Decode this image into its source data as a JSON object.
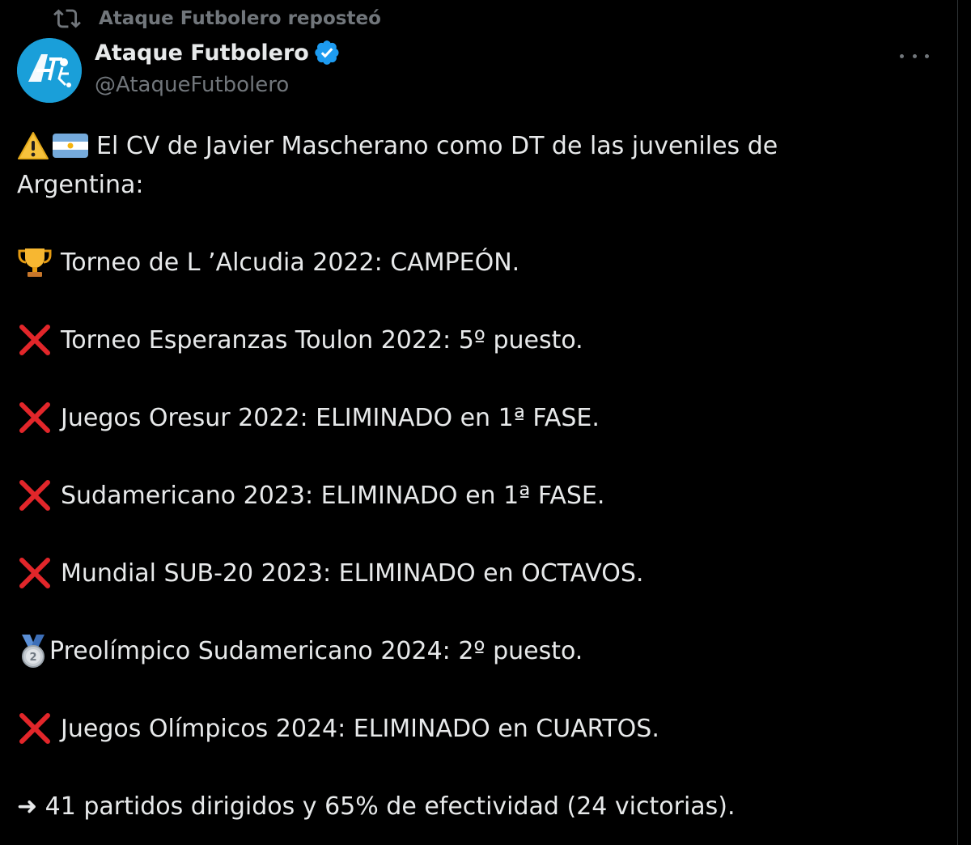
{
  "repost": {
    "text": "Ataque Futbolero reposteó",
    "icon": "repost-icon"
  },
  "author": {
    "name": "Ataque Futbolero",
    "handle": "@AtaqueFutbolero",
    "avatar_color": "#1a9fd9",
    "verified_color": "#1d9bf0"
  },
  "tweet": {
    "intro_line1": "El CV de Javier Mascherano como DT de las juveniles de",
    "intro_line2": "Argentina:",
    "items": [
      {
        "icon": "trophy-icon",
        "text": "Torneo de L ’Alcudia 2022: CAMPEÓN."
      },
      {
        "icon": "cross-mark-icon",
        "text": "Torneo Esperanzas Toulon 2022: 5º puesto."
      },
      {
        "icon": "cross-mark-icon",
        "text": "Juegos Oresur 2022: ELIMINADO en 1ª FASE."
      },
      {
        "icon": "cross-mark-icon",
        "text": "Sudamericano 2023: ELIMINADO en 1ª FASE."
      },
      {
        "icon": "cross-mark-icon",
        "text": "Mundial SUB-20 2023: ELIMINADO en OCTAVOS."
      },
      {
        "icon": "silver-medal-icon",
        "text": "Preolímpico Sudamericano 2024: 2º puesto."
      },
      {
        "icon": "cross-mark-icon",
        "text": "Juegos Olímpicos 2024: ELIMINADO en CUARTOS."
      }
    ],
    "summary": "➜ 41 partidos dirigidos y 65% de efectividad (24 victorias)."
  },
  "colors": {
    "background": "#000000",
    "text": "#e7e9ea",
    "secondary": "#71767b",
    "cross": "#e2262a"
  }
}
